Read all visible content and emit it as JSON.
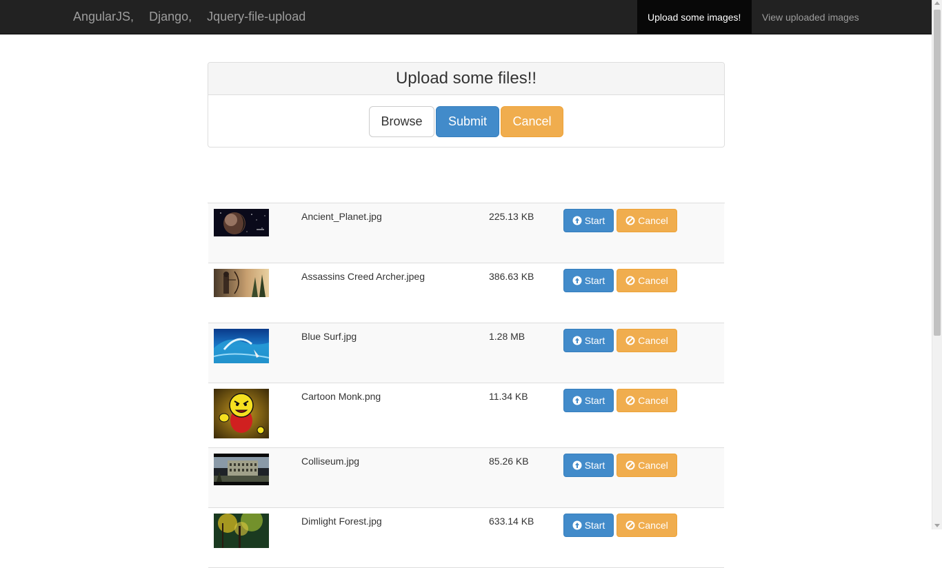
{
  "navbar": {
    "brand": [
      "AngularJS,",
      "Django,",
      "Jquery-file-upload"
    ],
    "links": [
      {
        "label": "Upload some images!",
        "active": true
      },
      {
        "label": "View uploaded images",
        "active": false
      }
    ]
  },
  "panel": {
    "title": "Upload some files!!",
    "browse_label": "Browse",
    "submit_label": "Submit",
    "cancel_label": "Cancel"
  },
  "files": [
    {
      "name": "Ancient_Planet.jpg",
      "size": "225.13 KB",
      "start_label": "Start",
      "cancel_label": "Cancel",
      "thumb": "planet-thumbnail"
    },
    {
      "name": "Assassins Creed Archer.jpeg",
      "size": "386.63 KB",
      "start_label": "Start",
      "cancel_label": "Cancel",
      "thumb": "archer-thumbnail"
    },
    {
      "name": "Blue Surf.jpg",
      "size": "1.28 MB",
      "start_label": "Start",
      "cancel_label": "Cancel",
      "thumb": "surf-thumbnail"
    },
    {
      "name": "Cartoon Monk.png",
      "size": "11.34 KB",
      "start_label": "Start",
      "cancel_label": "Cancel",
      "thumb": "monk-thumbnail"
    },
    {
      "name": "Colliseum.jpg",
      "size": "85.26 KB",
      "start_label": "Start",
      "cancel_label": "Cancel",
      "thumb": "colliseum-thumbnail"
    },
    {
      "name": "Dimlight Forest.jpg",
      "size": "633.14 KB",
      "start_label": "Start",
      "cancel_label": "Cancel",
      "thumb": "forest-thumbnail"
    }
  ],
  "icons": {
    "start": "circle-arrow-up-icon",
    "cancel": "ban-circle-icon"
  },
  "colors": {
    "navbar": "#222222",
    "primary": "#428bca",
    "warning": "#f0ad4e",
    "stripe": "#f9f9f9"
  }
}
